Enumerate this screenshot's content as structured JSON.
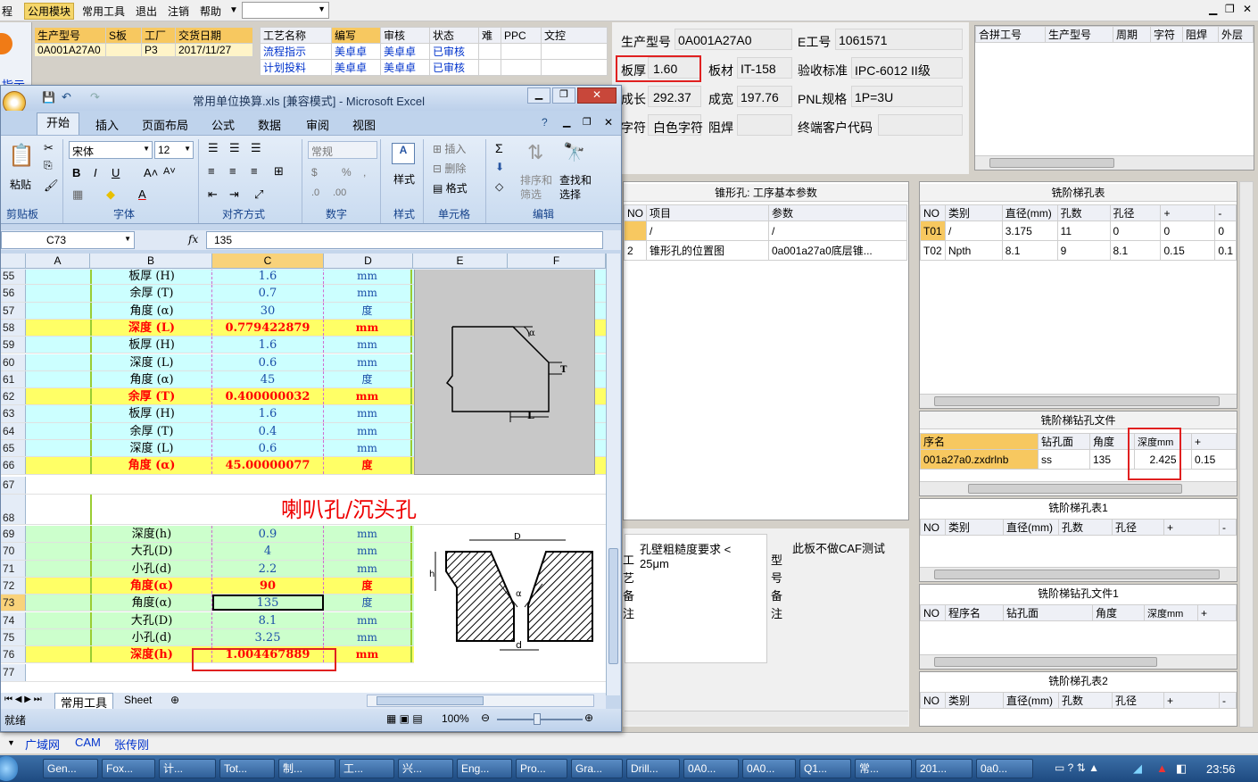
{
  "menu": {
    "items": [
      "程",
      "公用模块",
      "常用工具",
      "退出",
      "注销",
      "帮助"
    ],
    "dropdown": ""
  },
  "win_controls": {
    "min": "▁",
    "restore": "❐",
    "close": "✕"
  },
  "left_top": {
    "btn_label": "指示",
    "cols": [
      "生产型号",
      "S板",
      "工厂",
      "交货日期"
    ],
    "row": [
      "0A001A27A0",
      "",
      "P3",
      "2017/11/27"
    ]
  },
  "process": {
    "cols": [
      "工艺名称",
      "编写",
      "审核",
      "状态",
      "难",
      "PPC",
      "文控"
    ],
    "rows": [
      [
        "流程指示",
        "美卓卓",
        "美卓卓",
        "已审核"
      ],
      [
        "计划投料",
        "美卓卓",
        "美卓卓",
        "已审核"
      ]
    ]
  },
  "info": {
    "model_lbl": "生产型号",
    "model_val": "0A001A27A0",
    "eno_lbl": "E工号",
    "eno_val": "1061571",
    "thick_lbl": "板厚",
    "thick_val": "1.60",
    "mat_lbl": "板材",
    "mat_val": "IT-158",
    "std_lbl": "验收标准",
    "std_val": "IPC-6012 II级",
    "len_lbl": "成长",
    "len_val": "292.37",
    "wid_lbl": "成宽",
    "wid_val": "197.76",
    "pnl_lbl": "PNL规格",
    "pnl_val": "1P=3U",
    "char_lbl": "字符",
    "char_val": "白色字符",
    "weld_lbl": "阻焊",
    "cust_lbl": "终端客户代码"
  },
  "merge": {
    "cols": [
      "合拼工号",
      "生产型号",
      "周期",
      "字符",
      "阻焊",
      "外层"
    ]
  },
  "cone": {
    "title": "锥形孔: 工序基本参数",
    "cols": [
      "NO",
      "项目",
      "参数"
    ],
    "rows": [
      [
        "",
        "/",
        "/"
      ],
      [
        "2",
        "锥形孔的位置图",
        "0a001a27a0底层锥..."
      ]
    ]
  },
  "mill": {
    "title": "铣阶梯孔表",
    "cols": [
      "NO",
      "类别",
      "直径(mm)",
      "孔数",
      "孔径",
      "+",
      "-"
    ],
    "rows": [
      [
        "T01",
        "/",
        "3.175",
        "11",
        "0",
        "0",
        "0"
      ],
      [
        "T02",
        "Npth",
        "8.1",
        "9",
        "8.1",
        "0.15",
        "0.1"
      ]
    ]
  },
  "drillfile": {
    "title": "铣阶梯钻孔文件",
    "cols": [
      "序名",
      "钻孔面",
      "角度",
      "深度mm",
      "+"
    ],
    "row": [
      "001a27a0.zxdrlnb",
      "ss",
      "135",
      "2.425",
      "0.15"
    ]
  },
  "mill1": {
    "title": "铣阶梯孔表1",
    "cols": [
      "NO",
      "类别",
      "直径(mm)",
      "孔数",
      "孔径",
      "+",
      "-"
    ]
  },
  "drill1": {
    "title": "铣阶梯钻孔文件1",
    "cols": [
      "NO",
      "程序名",
      "钻孔面",
      "角度",
      "深度mm",
      "+"
    ]
  },
  "mill2": {
    "title": "铣阶梯孔表2",
    "cols": [
      "NO",
      "类别",
      "直径(mm)",
      "孔数",
      "孔径",
      "+",
      "-"
    ]
  },
  "notes": {
    "req": "孔壁粗糙度要求 < 25μm",
    "side1": "工艺备注",
    "side2": "型号备注",
    "caf": "此板不做CAF测试"
  },
  "bottom_tabs": [
    "广域网",
    "CAM",
    "张传刚"
  ],
  "excel": {
    "title": "常用单位换算.xls [兼容模式] - Microsoft Excel",
    "tabs": [
      "开始",
      "插入",
      "页面布局",
      "公式",
      "数据",
      "审阅",
      "视图"
    ],
    "groups": [
      "剪贴板",
      "字体",
      "对齐方式",
      "数字",
      "样式",
      "单元格",
      "编辑"
    ],
    "font": "宋体",
    "size": "12",
    "numfmt": "常规",
    "btns": {
      "paste": "粘贴",
      "style": "样式",
      "insert": "插入",
      "delete": "删除",
      "format": "格式",
      "sort": "排序和筛选",
      "find": "查找和选择"
    },
    "namebox": "C73",
    "formula": "135",
    "colheads": [
      "A",
      "B",
      "C",
      "D",
      "E",
      "F"
    ],
    "rows": [
      {
        "n": "55",
        "b": "板厚 (H)",
        "c": "1.6",
        "d": "mm",
        "s": "cyan"
      },
      {
        "n": "56",
        "b": "余厚 (T)",
        "c": "0.7",
        "d": "mm",
        "s": "cyan"
      },
      {
        "n": "57",
        "b": "角度 (α)",
        "c": "30",
        "d": "度",
        "s": "cyan"
      },
      {
        "n": "58",
        "b": "深度 (L)",
        "c": "0.779422879",
        "d": "mm",
        "s": "yel"
      },
      {
        "n": "59",
        "b": "板厚 (H)",
        "c": "1.6",
        "d": "mm",
        "s": "cyan"
      },
      {
        "n": "60",
        "b": "深度 (L)",
        "c": "0.6",
        "d": "mm",
        "s": "cyan"
      },
      {
        "n": "61",
        "b": "角度 (α)",
        "c": "45",
        "d": "度",
        "s": "cyan"
      },
      {
        "n": "62",
        "b": "余厚 (T)",
        "c": "0.400000032",
        "d": "mm",
        "s": "yel"
      },
      {
        "n": "63",
        "b": "板厚 (H)",
        "c": "1.6",
        "d": "mm",
        "s": "cyan"
      },
      {
        "n": "64",
        "b": "余厚 (T)",
        "c": "0.4",
        "d": "mm",
        "s": "cyan"
      },
      {
        "n": "65",
        "b": "深度 (L)",
        "c": "0.6",
        "d": "mm",
        "s": "cyan"
      },
      {
        "n": "66",
        "b": "角度 (α)",
        "c": "45.00000077",
        "d": "度",
        "s": "yel"
      }
    ],
    "row67": "67",
    "section_row": "68",
    "section_title": "喇叭孔/沉头孔",
    "rows2": [
      {
        "n": "69",
        "b": "深度(h)",
        "c": "0.9",
        "d": "mm",
        "s": "gr"
      },
      {
        "n": "70",
        "b": "大孔(D)",
        "c": "4",
        "d": "mm",
        "s": "gr"
      },
      {
        "n": "71",
        "b": "小孔(d)",
        "c": "2.2",
        "d": "mm",
        "s": "gr"
      },
      {
        "n": "72",
        "b": "角度(α)",
        "c": "90",
        "d": "度",
        "s": "yel"
      },
      {
        "n": "73",
        "b": "角度(α)",
        "c": "135",
        "d": "度",
        "s": "gr"
      },
      {
        "n": "74",
        "b": "大孔(D)",
        "c": "8.1",
        "d": "mm",
        "s": "gr"
      },
      {
        "n": "75",
        "b": "小孔(d)",
        "c": "3.25",
        "d": "mm",
        "s": "gr"
      },
      {
        "n": "76",
        "b": "深度(h)",
        "c": "1.004467889",
        "d": "mm",
        "s": "yel"
      }
    ],
    "row77": "77",
    "sheet_tabs": [
      "常用工具",
      "Sheet"
    ],
    "status": "就绪",
    "zoom": "100%",
    "diag1": {
      "alpha": "α",
      "t": "T",
      "l": "L"
    },
    "diag2": {
      "D": "D",
      "d": "d",
      "h": "h",
      "a": "α"
    }
  },
  "taskbar": {
    "items": [
      "Gen...",
      "Fox...",
      "计...",
      "Tot...",
      "制...",
      "工...",
      "兴...",
      "Eng...",
      "Pro...",
      "Gra...",
      "Drill...",
      "0A0...",
      "0A0...",
      "Q1...",
      "常...",
      "201...",
      "0a0..."
    ],
    "time": "23:56"
  }
}
